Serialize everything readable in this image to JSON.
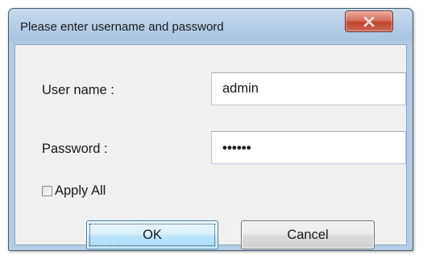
{
  "window": {
    "title": "Please enter username and password",
    "close_glyph": "X"
  },
  "form": {
    "username_label": "User name :",
    "username_value": "admin",
    "password_label": "Password :",
    "password_value": "••••••",
    "apply_all_label": "Apply All",
    "apply_all_checked": false
  },
  "buttons": {
    "ok_label": "OK",
    "cancel_label": "Cancel"
  },
  "icons": {
    "close": "close-icon"
  },
  "colors": {
    "titlebar": "#b8cfe7",
    "close_button": "#c2432c",
    "ok_button_highlight": "#bee6fd",
    "dialog_background": "#f0f0f0"
  }
}
